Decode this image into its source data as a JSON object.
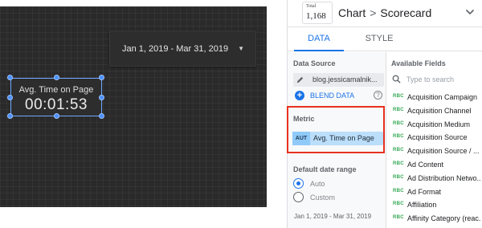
{
  "canvas": {
    "date_range": "Jan 1, 2019 - Mar 31, 2019",
    "scorecard": {
      "label": "Avg. Time on Page",
      "value": "00:01:53"
    }
  },
  "panel": {
    "thumb": {
      "caption": "Total",
      "value": "1,168"
    },
    "title_chart": "Chart",
    "title_separator": ">",
    "title_type": "Scorecard",
    "tabs": [
      "DATA",
      "STYLE"
    ],
    "data_source": {
      "title": "Data Source",
      "name": "blog.jessicamalnik...",
      "blend_label": "BLEND DATA"
    },
    "metric": {
      "title": "Metric",
      "type": "AUT",
      "name": "Avg. Time on Page"
    },
    "date_range": {
      "title": "Default date range",
      "options": [
        "Auto",
        "Custom"
      ],
      "selected": "Auto",
      "value": "Jan 1, 2019 - Mar 31, 2019"
    },
    "available_fields": {
      "title": "Available Fields",
      "search_placeholder": "Type to search",
      "type_tag": "RBC",
      "items": [
        "Acquisition Campaign",
        "Acquisition Channel",
        "Acquisition Medium",
        "Acquisition Source",
        "Acquisition Source / ...",
        "Ad Content",
        "Ad Distribution Netwo...",
        "Ad Format",
        "Affiliation",
        "Affinity Category (reac..."
      ]
    }
  },
  "colors": {
    "accent": "#1a73e8",
    "highlight_box": "#e8311e",
    "metric_chip": "#bbdefb",
    "dimension_tag": "#34a853",
    "canvas_bg": "#2a2a2a"
  }
}
